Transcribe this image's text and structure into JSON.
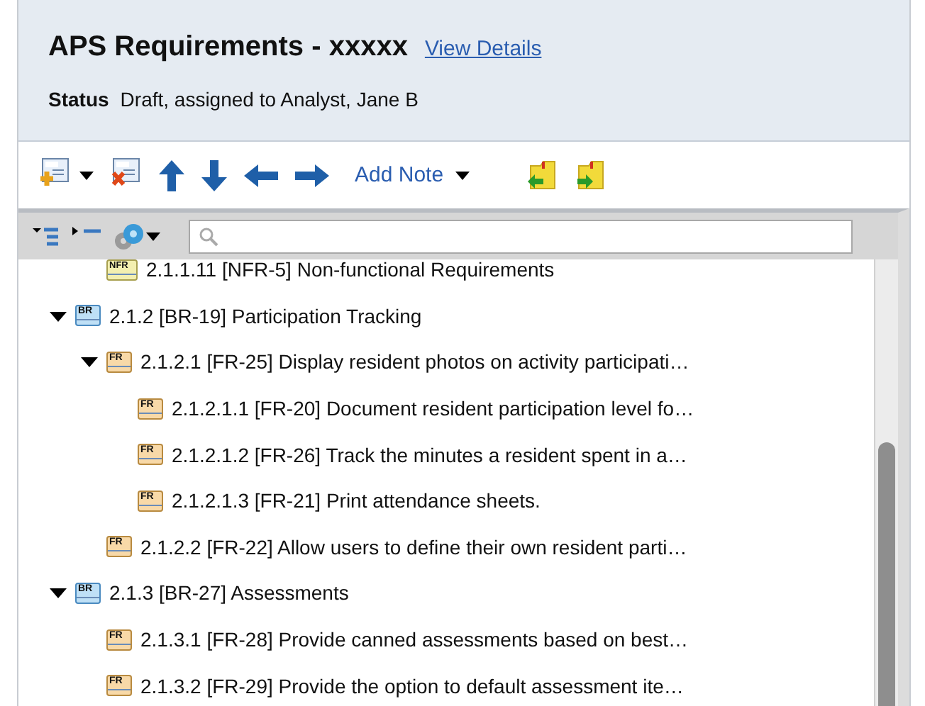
{
  "header": {
    "title": "APS Requirements - xxxxx",
    "link": "View Details",
    "status_label": "Status",
    "status_value": "Draft, assigned to Analyst, Jane B"
  },
  "toolbar": {
    "note_button": "Add Note"
  },
  "tree": {
    "items": [
      {
        "children": [
          {
            "tag": "NFR",
            "kind": "nfr",
            "label": "2.1.1.11 [NFR-5] Non-functional Requirements"
          }
        ]
      },
      {
        "tag": "BR",
        "kind": "br",
        "label": "2.1.2 [BR-19] Participation Tracking",
        "expanded": true,
        "children": [
          {
            "tag": "FR",
            "kind": "fr",
            "label": "2.1.2.1 [FR-25] Display resident photos on activity participati…",
            "expanded": true,
            "children": [
              {
                "tag": "FR",
                "kind": "fr",
                "label": "2.1.2.1.1 [FR-20] Document resident participation level fo…"
              },
              {
                "tag": "FR",
                "kind": "fr",
                "label": "2.1.2.1.2 [FR-26] Track the minutes a resident spent in a…"
              },
              {
                "tag": "FR",
                "kind": "fr",
                "label": "2.1.2.1.3 [FR-21] Print attendance sheets."
              }
            ]
          },
          {
            "tag": "FR",
            "kind": "fr",
            "label": "2.1.2.2 [FR-22] Allow users to define their own resident parti…"
          }
        ]
      },
      {
        "tag": "BR",
        "kind": "br",
        "label": "2.1.3 [BR-27] Assessments",
        "expanded": true,
        "children": [
          {
            "tag": "FR",
            "kind": "fr",
            "label": "2.1.3.1 [FR-28] Provide canned assessments based on best…"
          },
          {
            "tag": "FR",
            "kind": "fr",
            "label": "2.1.3.2 [FR-29] Provide the option to default assessment ite…"
          }
        ]
      }
    ]
  }
}
